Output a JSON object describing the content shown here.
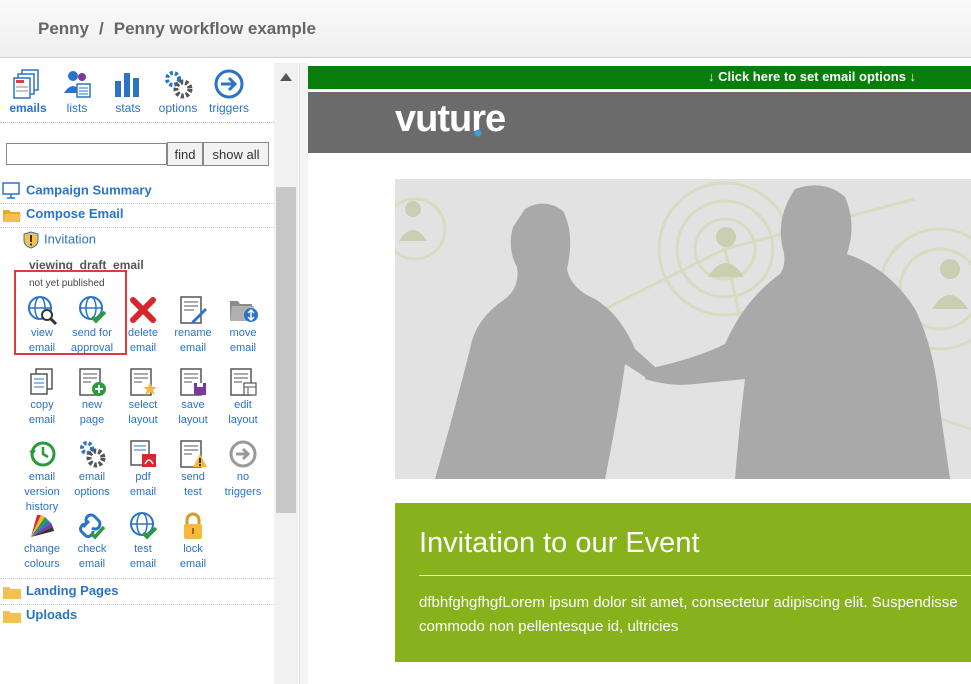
{
  "header": {
    "breadcrumb": [
      "Penny",
      "Penny workflow example"
    ],
    "separator": "/"
  },
  "sidebar": {
    "nav": [
      {
        "label": "emails",
        "icon": "emails-icon",
        "active": true
      },
      {
        "label": "lists",
        "icon": "lists-icon"
      },
      {
        "label": "stats",
        "icon": "stats-icon"
      },
      {
        "label": "options",
        "icon": "options-gear-icon"
      },
      {
        "label": "triggers",
        "icon": "triggers-arrow-icon"
      }
    ],
    "search": {
      "value": "",
      "placeholder": ""
    },
    "find_label": "find",
    "show_all_label": "show all",
    "tree": {
      "campaign_summary": "Campaign Summary",
      "compose_email": "Compose Email",
      "invitation": "Invitation",
      "landing_pages": "Landing Pages",
      "uploads": "Uploads"
    },
    "viewing_label": "viewing_draft_email",
    "status_label": "not yet published",
    "actions": [
      {
        "line1": "view",
        "line2": "email",
        "icon": "view-email-icon"
      },
      {
        "line1": "send for",
        "line2": "approval",
        "icon": "send-for-approval-icon"
      },
      {
        "line1": "delete",
        "line2": "email",
        "icon": "delete-icon"
      },
      {
        "line1": "rename",
        "line2": "email",
        "icon": "rename-icon"
      },
      {
        "line1": "move",
        "line2": "email",
        "icon": "move-icon"
      },
      {
        "line1": "copy",
        "line2": "email",
        "icon": "copy-icon"
      },
      {
        "line1": "new",
        "line2": "page",
        "icon": "new-page-icon"
      },
      {
        "line1": "select",
        "line2": "layout",
        "icon": "select-layout-icon"
      },
      {
        "line1": "save",
        "line2": "layout",
        "icon": "save-layout-icon"
      },
      {
        "line1": "edit",
        "line2": "layout",
        "icon": "edit-layout-icon"
      },
      {
        "line1": "email",
        "line2": "version",
        "line3": "history",
        "icon": "version-history-icon"
      },
      {
        "line1": "email",
        "line2": "options",
        "icon": "email-options-icon"
      },
      {
        "line1": "pdf",
        "line2": "email",
        "icon": "pdf-icon"
      },
      {
        "line1": "send",
        "line2": "test",
        "icon": "send-test-icon"
      },
      {
        "line1": "no",
        "line2": "triggers",
        "icon": "no-triggers-icon"
      },
      {
        "line1": "change",
        "line2": "colours",
        "icon": "colour-palette-icon"
      },
      {
        "line1": "check",
        "line2": "email",
        "icon": "check-email-icon"
      },
      {
        "line1": "test",
        "line2": "email",
        "icon": "test-email-icon"
      },
      {
        "line1": "lock",
        "line2": "email",
        "icon": "lock-icon"
      }
    ]
  },
  "preview": {
    "options_bar": "↓   Click here to set email options   ↓",
    "logo": "vuture",
    "event_title": "Invitation to our Event",
    "event_body_line1": "dfbhfghgfhgfLorem ipsum dolor sit amet, consectetur adipiscing elit. Suspendisse",
    "event_body_line2": "commodo non pellentesque id, ultricies"
  },
  "colors": {
    "link_blue": "#2a73c9",
    "options_bar_green": "#0a7e0a",
    "event_panel_green": "#87b21c",
    "brand_bar_grey": "#6b6b6b",
    "highlight_red": "#e0393e"
  }
}
